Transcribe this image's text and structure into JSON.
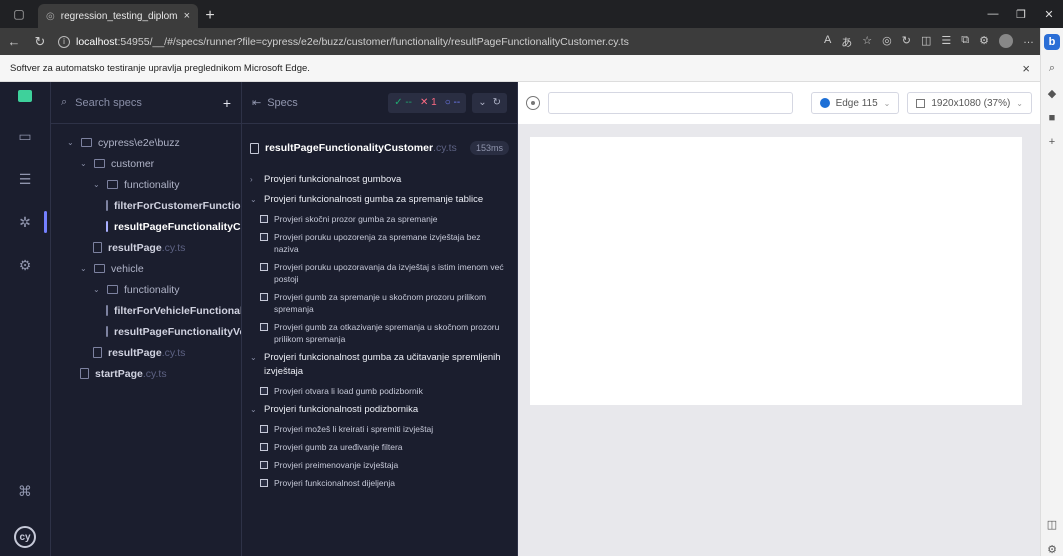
{
  "browser": {
    "tab_title": "regression_testing_diplomski",
    "tab_close": "×",
    "new_tab": "+",
    "url_host": "localhost",
    "url_rest": ":54955/__/#/specs/runner?file=cypress/e2e/buzz/customer/functionality/resultPageFunctionalityCustomer.cy.ts",
    "infobar_text": "Softver za automatsko testiranje upravlja preglednikom Microsoft Edge.",
    "infobar_close": "×"
  },
  "specs_panel": {
    "search_placeholder": "Search specs",
    "add_label": "+",
    "tree": [
      {
        "kind": "folder",
        "label": "cypress\\e2e\\buzz",
        "ext": "",
        "level": 0
      },
      {
        "kind": "folder",
        "label": "customer",
        "ext": "",
        "level": 1
      },
      {
        "kind": "folder",
        "label": "functionality",
        "ext": "",
        "level": 2
      },
      {
        "kind": "file",
        "label": "filterForCustomerFunctiona...",
        "ext": "",
        "level": 3
      },
      {
        "kind": "file",
        "label": "resultPageFunctionalityCus...",
        "ext": "",
        "level": 3,
        "current": true
      },
      {
        "kind": "file",
        "label": "resultPage",
        "ext": ".cy.ts",
        "level": 2
      },
      {
        "kind": "folder",
        "label": "vehicle",
        "ext": "",
        "level": 1
      },
      {
        "kind": "folder",
        "label": "functionality",
        "ext": "",
        "level": 2
      },
      {
        "kind": "file",
        "label": "filterForVehicleFunctionalit...",
        "ext": "",
        "level": 3
      },
      {
        "kind": "file",
        "label": "resultPageFunctionalityVeh...",
        "ext": "",
        "level": 3
      },
      {
        "kind": "file",
        "label": "resultPage",
        "ext": ".cy.ts",
        "level": 2
      },
      {
        "kind": "file",
        "label": "startPage",
        "ext": ".cy.ts",
        "level": 1
      }
    ]
  },
  "reporter": {
    "specs_label": "Specs",
    "passed": "✓ --",
    "failed": "✕ 1",
    "pending": "○ --",
    "spec_name": "resultPageFunctionalityCustomer",
    "spec_ext": ".cy.ts",
    "duration": "153ms",
    "items": [
      {
        "type": "suite",
        "text": "Provjeri funkcionalnost gumbova",
        "chev": "›"
      },
      {
        "type": "suite",
        "text": "Provjeri funkcionalnosti gumba za spremanje tablice",
        "chev": "⌄"
      },
      {
        "type": "test",
        "text": "Provjeri skočni prozor gumba za spremanje"
      },
      {
        "type": "test",
        "text": "Provjeri poruku upozorenja za spremane izvještaja bez naziva"
      },
      {
        "type": "test",
        "text": "Provjeri poruku upozoravanja da izvještaj s istim imenom već postoji"
      },
      {
        "type": "test",
        "text": "Provjeri gumb za spremanje u skočnom prozoru prilikom spremanja"
      },
      {
        "type": "test",
        "text": "Provjeri gumb za otkazivanje spremanja u skočnom prozoru prilikom spremanja"
      },
      {
        "type": "suite",
        "text": "Provjeri funkcionalnost gumba za učitavanje spremljenih izvještaja",
        "chev": "⌄"
      },
      {
        "type": "test",
        "text": "Provjeri otvara li load gumb podizbornik"
      },
      {
        "type": "suite",
        "text": "Provjeri funkcionalnosti podizbornika",
        "chev": "⌄"
      },
      {
        "type": "test",
        "text": "Provjeri možeš li kreirati i spremiti izvještaj"
      },
      {
        "type": "test",
        "text": "Provjeri gumb za uređivanje filtera"
      },
      {
        "type": "test",
        "text": "Provjeri preimenovanje izvještaja"
      },
      {
        "type": "test",
        "text": "Provjeri funkcionalnost dijeljenja"
      }
    ]
  },
  "aut": {
    "browser_label": "Edge 115",
    "viewport_label": "1920x1080 (37%)"
  }
}
